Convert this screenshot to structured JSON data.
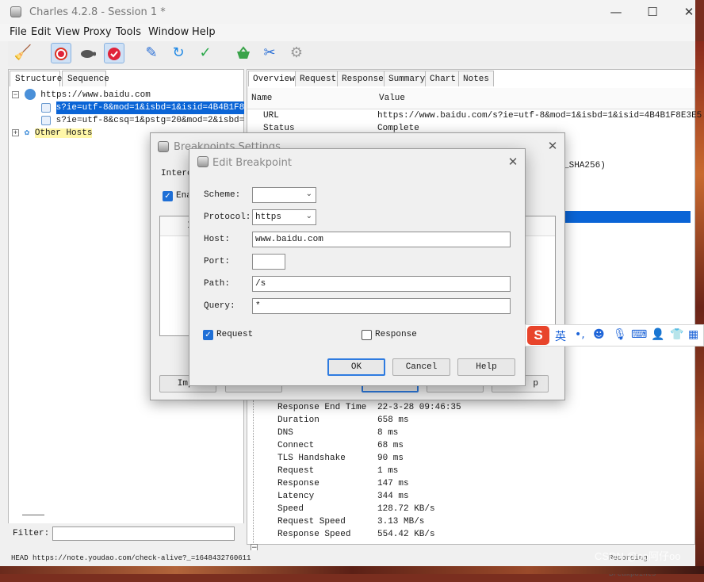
{
  "window": {
    "title": "Charles 4.2.8 - Session 1 *",
    "controls": {
      "minimize": "—",
      "maximize": "☐",
      "close": "✕"
    }
  },
  "menu": [
    "File",
    "Edit",
    "View",
    "Proxy",
    "Tools",
    "Window",
    "Help"
  ],
  "toolbar": {
    "icons": [
      "broom-icon",
      "record-icon",
      "throttle-turtle-icon",
      "breakpoints-icon",
      "pen-icon",
      "refresh-icon",
      "check-icon",
      "basket-icon",
      "tools-icon",
      "settings-gear-icon"
    ]
  },
  "left_pane": {
    "tabs": [
      "Structure",
      "Sequence"
    ],
    "tree": {
      "host": "https://www.baidu.com",
      "children": [
        "s?ie=utf-8&mod=1&isbd=1&isid=4B4B1F8E3E5",
        "s?ie=utf-8&csq=1&pstg=20&mod=2&isbd=1&cq"
      ],
      "other": "Other Hosts"
    },
    "filter_label": "Filter:",
    "filter_value": ""
  },
  "right_pane": {
    "tabs": [
      "Overview",
      "Request",
      "Response",
      "Summary",
      "Chart",
      "Notes"
    ],
    "columns": [
      "Name",
      "Value"
    ],
    "top_rows": [
      {
        "name": "URL",
        "value": "https://www.baidu.com/s?ie=utf-8&mod=1&isbd=1&isid=4B4B1F8E3E5..."
      },
      {
        "name": "Status",
        "value": "Complete"
      }
    ],
    "partial_value": "_SHA256)",
    "timing_rows": [
      {
        "name": "Response End Time",
        "value": "22-3-28 09:46:35"
      },
      {
        "name": "Duration",
        "value": "658 ms"
      },
      {
        "name": "DNS",
        "value": "8 ms"
      },
      {
        "name": "Connect",
        "value": "68 ms"
      },
      {
        "name": "TLS Handshake",
        "value": "90 ms"
      },
      {
        "name": "Request",
        "value": "1 ms"
      },
      {
        "name": "Response",
        "value": "147 ms"
      },
      {
        "name": "Latency",
        "value": "344 ms"
      },
      {
        "name": "Speed",
        "value": "128.72 KB/s"
      },
      {
        "name": "Request Speed",
        "value": "3.13 MB/s"
      },
      {
        "name": "Response Speed",
        "value": "554.42 KB/s"
      }
    ]
  },
  "status_bar": {
    "text": "HEAD https://note.youdao.com/check-alive?_=1648432760611",
    "right": "Recording  Breakpoints",
    "watermark": "CSDN @oo阿仔oo"
  },
  "breakpoints_dialog": {
    "title": "Breakpoints Settings",
    "intercept_label": "Interc",
    "enable_label": "Ena",
    "list_header": "I",
    "buttons": [
      "Impo",
      "",
      "",
      "p"
    ]
  },
  "edit_dialog": {
    "title": "Edit Breakpoint",
    "scheme_label": "Scheme:",
    "scheme_value": "",
    "protocol_label": "Protocol:",
    "protocol_value": "https",
    "host_label": "Host:",
    "host_value": "www.baidu.com",
    "port_label": "Port:",
    "port_value": "",
    "path_label": "Path:",
    "path_value": "/s",
    "query_label": "Query:",
    "query_value": "*",
    "request_label": "Request",
    "request_checked": true,
    "response_label": "Response",
    "response_checked": false,
    "ok_label": "OK",
    "cancel_label": "Cancel",
    "help_label": "Help"
  },
  "ime_bar": {
    "icons": [
      "sogou-logo-icon",
      "lang-toggle-icon",
      "punctuation-icon",
      "emoji-icon",
      "mic-icon",
      "keyboard-icon",
      "user-icon",
      "skin-icon",
      "apps-icon"
    ],
    "lang": "英",
    "punct": "•,"
  }
}
